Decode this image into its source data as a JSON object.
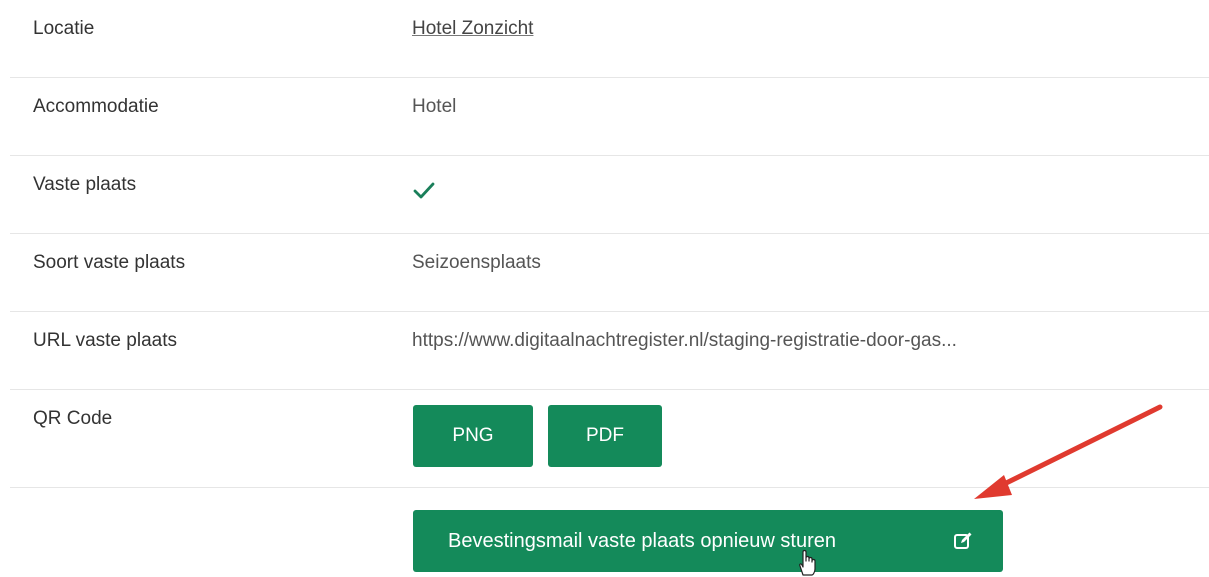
{
  "rows": [
    {
      "label": "Locatie",
      "value": "Hotel Zonzicht"
    },
    {
      "label": "Accommodatie",
      "value": "Hotel"
    },
    {
      "label": "Vaste plaats",
      "value": ""
    },
    {
      "label": "Soort vaste plaats",
      "value": "Seizoensplaats"
    },
    {
      "label": "URL vaste plaats",
      "value": "https://www.digitaalnachtregister.nl/staging-registratie-door-gas..."
    },
    {
      "label": "QR Code",
      "value": ""
    }
  ],
  "qr_buttons": {
    "png_label": "PNG",
    "pdf_label": "PDF"
  },
  "actions": {
    "resend_label": "Bevestingsmail vaste plaats opnieuw sturen"
  },
  "icons": {
    "check": "check-icon",
    "edit": "edit-icon",
    "cursor": "hand-cursor-icon",
    "annotation": "red-arrow"
  },
  "colors": {
    "primary": "#148a5a",
    "check": "#1a7f5a",
    "arrow": "#e03a2f",
    "divider": "#e6e6e6"
  }
}
